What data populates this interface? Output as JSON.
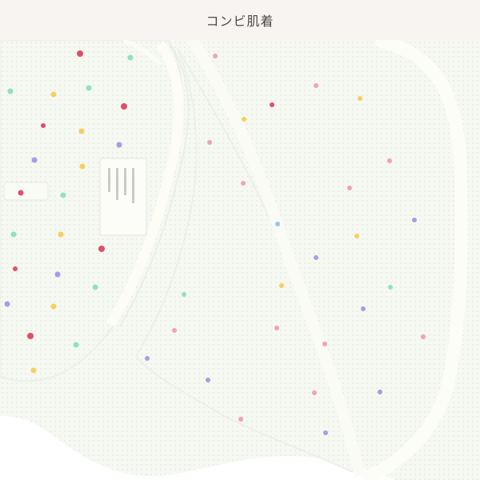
{
  "header": {
    "title": "コンビ肌着"
  },
  "photo": {
    "subject": "baby-combination-undershirt",
    "colors": {
      "background": "#ffffff",
      "header_bg": "#f8f4f2",
      "fabric": "#f7f9f3",
      "fabric_shadow": "#e9efe4",
      "binding": "#fdfdf8",
      "print_pink": "#f2a1b4",
      "print_red": "#e24d6a",
      "print_yellow": "#f3d15c",
      "print_mint": "#8fe0c7",
      "print_purple": "#a99be8",
      "print_blue": "#92c6f0"
    }
  }
}
